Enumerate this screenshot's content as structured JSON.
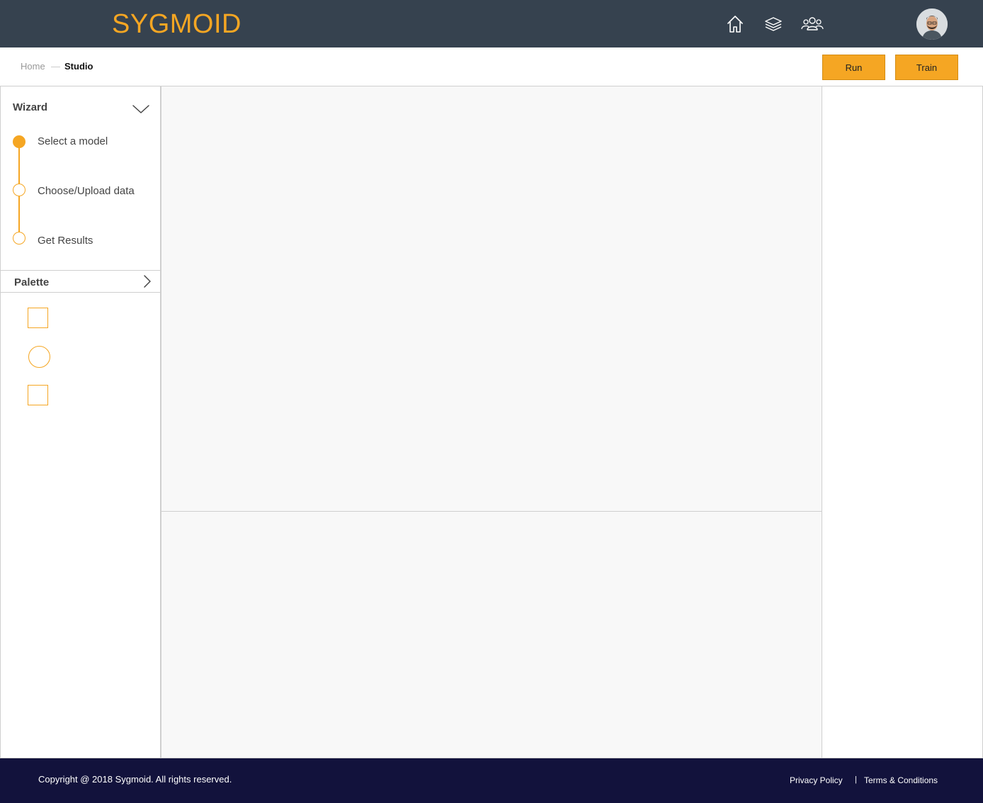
{
  "header": {
    "logo_text": "SYGMOID",
    "nav_icons": [
      "home-icon",
      "layers-icon",
      "users-icon"
    ],
    "avatar_icon": "user-avatar"
  },
  "breadcrumb": {
    "home": "Home",
    "separator": "—",
    "current": "Studio"
  },
  "actions": {
    "run_label": "Run",
    "train_label": "Train"
  },
  "wizard": {
    "title": "Wizard",
    "steps": [
      {
        "label": "Select a model",
        "active": true
      },
      {
        "label": "Choose/Upload data",
        "active": false
      },
      {
        "label": "Get Results",
        "active": false
      }
    ]
  },
  "palette": {
    "title": "Palette",
    "shapes": [
      "square",
      "circle",
      "square"
    ]
  },
  "footer": {
    "copyright": "Copyright @ 2018 Sygmoid. All rights reserved.",
    "privacy_label": "Privacy Policy",
    "separator": "|",
    "terms_label": "Terms & Conditions"
  },
  "colors": {
    "header_bg": "#36424f",
    "accent": "#f5a623",
    "footer_bg": "#12123c",
    "canvas_bg": "#f8f8f8"
  }
}
